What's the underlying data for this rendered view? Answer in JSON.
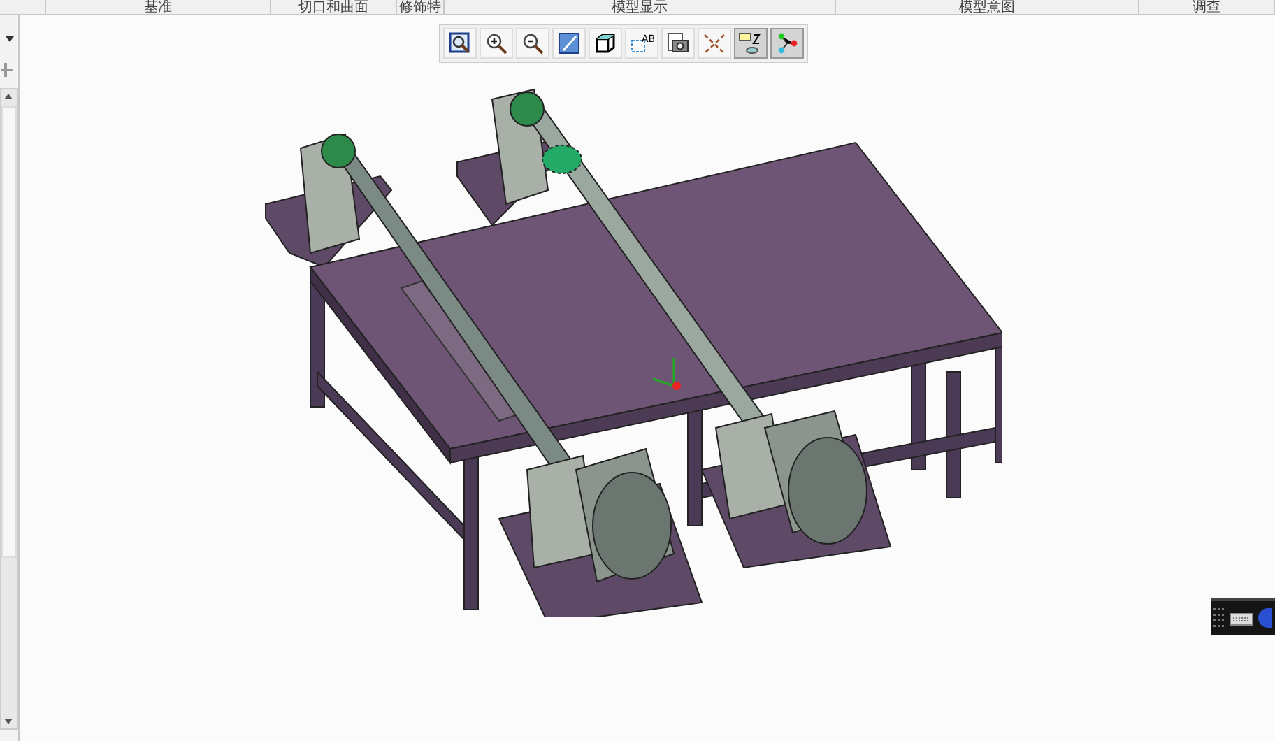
{
  "ribbon_groups": [
    {
      "label": "基准"
    },
    {
      "label": "切口和曲面"
    },
    {
      "label": "修饰特"
    },
    {
      "label": "模型显示"
    },
    {
      "label": "模型意图"
    },
    {
      "label": "调查"
    }
  ],
  "view_toolbar": [
    {
      "kind": "zoom-fit",
      "selected": false
    },
    {
      "kind": "zoom-in",
      "selected": false
    },
    {
      "kind": "zoom-out",
      "selected": false
    },
    {
      "kind": "repaint",
      "selected": false
    },
    {
      "kind": "display-style",
      "selected": false
    },
    {
      "kind": "saved-views",
      "selected": false,
      "label": "AB"
    },
    {
      "kind": "camera",
      "selected": false
    },
    {
      "kind": "datum-planes",
      "selected": false
    },
    {
      "kind": "annotations",
      "selected": true
    },
    {
      "kind": "spin-center",
      "selected": true
    }
  ]
}
